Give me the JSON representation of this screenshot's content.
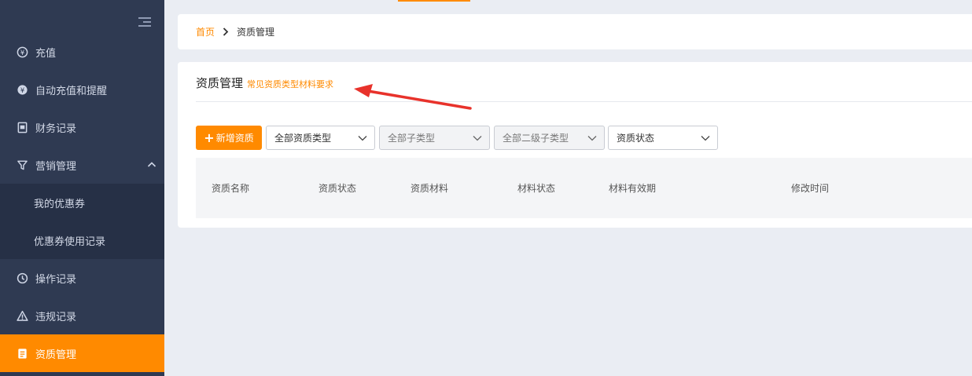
{
  "sidebar": {
    "items": [
      {
        "label": "充值",
        "icon": "yuan-circle-icon"
      },
      {
        "label": "自动充值和提醒",
        "icon": "yuan-cycle-icon"
      },
      {
        "label": "财务记录",
        "icon": "ledger-icon"
      },
      {
        "label": "营销管理",
        "icon": "funnel-icon"
      },
      {
        "label": "我的优惠券"
      },
      {
        "label": "优惠券使用记录"
      },
      {
        "label": "操作记录",
        "icon": "history-icon"
      },
      {
        "label": "违规记录",
        "icon": "warning-icon"
      },
      {
        "label": "资质管理",
        "icon": "document-icon"
      }
    ]
  },
  "breadcrumb": {
    "home": "首页",
    "current": "资质管理"
  },
  "card": {
    "title": "资质管理",
    "link": "常见资质类型材料要求"
  },
  "toolbar": {
    "add_label": "新增资质",
    "filters": [
      "全部资质类型",
      "全部子类型",
      "全部二级子类型",
      "资质状态"
    ]
  },
  "table": {
    "columns": [
      "资质名称",
      "资质状态",
      "资质材料",
      "材料状态",
      "材料有效期",
      "修改时间"
    ]
  },
  "colors": {
    "accent": "#ff8a00",
    "sidebar": "#2f3a52",
    "annotation": "#e8322b"
  }
}
